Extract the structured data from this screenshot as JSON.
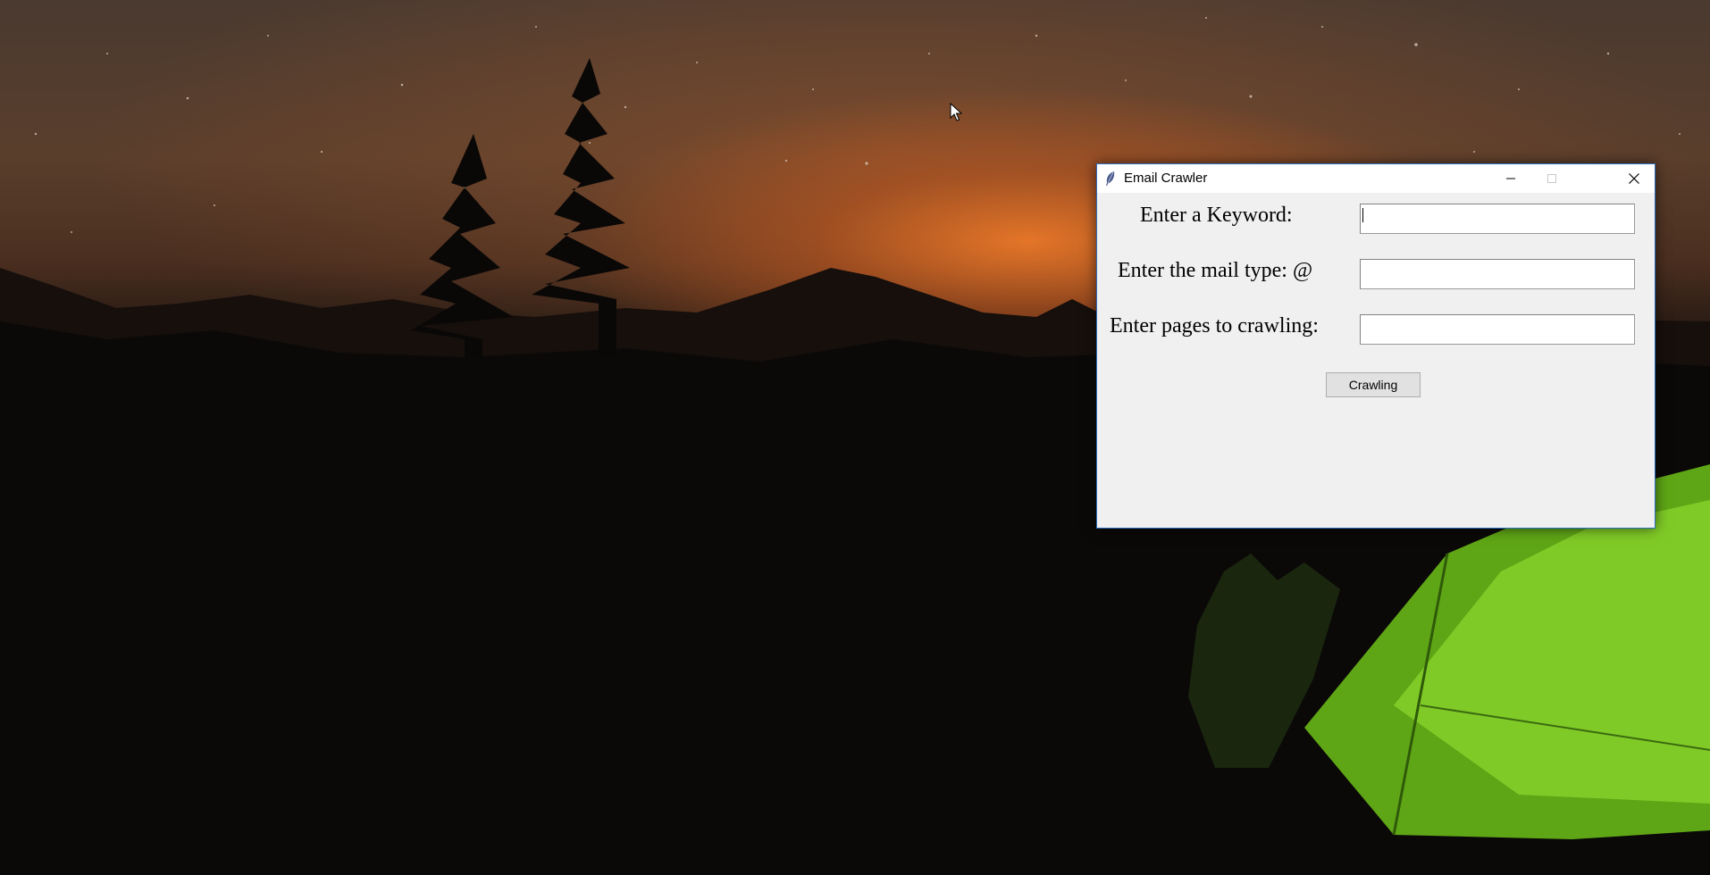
{
  "desktop": {
    "wallpaper": "night mountain landscape with trees and glowing green tent",
    "colors": {
      "sky_glow": "#e07a2c",
      "tent_green": "#7ecb1e"
    }
  },
  "window": {
    "title": "Email Crawler",
    "icon": "feather-icon",
    "controls": {
      "minimize": "minimize-icon",
      "maximize": "maximize-icon",
      "close": "close-icon"
    },
    "accent_border": "#2b6fbe"
  },
  "form": {
    "keyword_label": "Enter a Keyword:",
    "keyword_value": "",
    "mailtype_label": "Enter the mail type: @",
    "mailtype_value": "",
    "pages_label": "Enter pages to crawling:",
    "pages_value": "",
    "crawl_button": "Crawling"
  }
}
